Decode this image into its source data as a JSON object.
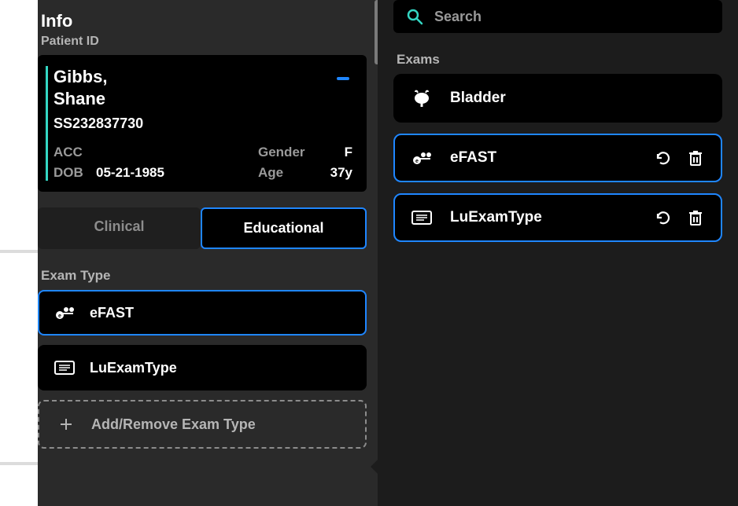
{
  "info": {
    "title": "Info",
    "subtitle": "Patient ID",
    "patient": {
      "name_line1": "Gibbs,",
      "name_line2": "Shane",
      "id": "SS232837730",
      "acc_label": "ACC",
      "acc_value": "",
      "dob_label": "DOB",
      "dob_value": "05-21-1985",
      "gender_label": "Gender",
      "gender_value": "F",
      "age_label": "Age",
      "age_value": "37y"
    },
    "mode": {
      "clinical": "Clinical",
      "educational": "Educational"
    },
    "exam_type_header": "Exam Type",
    "exam_types": [
      {
        "label": "eFAST",
        "icon": "efast-icon",
        "selected": true
      },
      {
        "label": "LuExamType",
        "icon": "form-icon",
        "selected": false
      }
    ],
    "add_remove": "Add/Remove Exam Type"
  },
  "right": {
    "search_placeholder": "Search",
    "exams_header": "Exams",
    "exams": [
      {
        "label": "Bladder",
        "icon": "bladder-icon",
        "selected": false,
        "actions": false
      },
      {
        "label": "eFAST",
        "icon": "efast-icon",
        "selected": true,
        "actions": true
      },
      {
        "label": "LuExamType",
        "icon": "form-icon",
        "selected": true,
        "actions": true
      }
    ]
  },
  "colors": {
    "accent": "#1f86ff",
    "teal": "#34d6c3"
  }
}
